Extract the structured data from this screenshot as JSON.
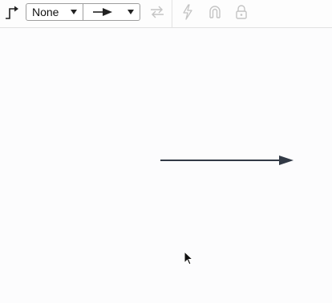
{
  "toolbar": {
    "connector_type_icon": "elbow-connector-icon",
    "start_arrowhead": {
      "label": "None",
      "dropdown_icon": "caret-down-icon"
    },
    "end_arrowhead": {
      "icon": "filled-arrow-icon",
      "dropdown_icon": "caret-down-icon"
    },
    "swap_icon": "swap-arrows-icon",
    "lightning_icon": "lightning-icon",
    "magnet_icon": "magnet-icon",
    "lock_icon": "lock-icon"
  },
  "colors": {
    "connector": "#323a46",
    "icon_default": "#222222",
    "icon_disabled": "#c4c4c4",
    "border": "#9e9e9e"
  }
}
